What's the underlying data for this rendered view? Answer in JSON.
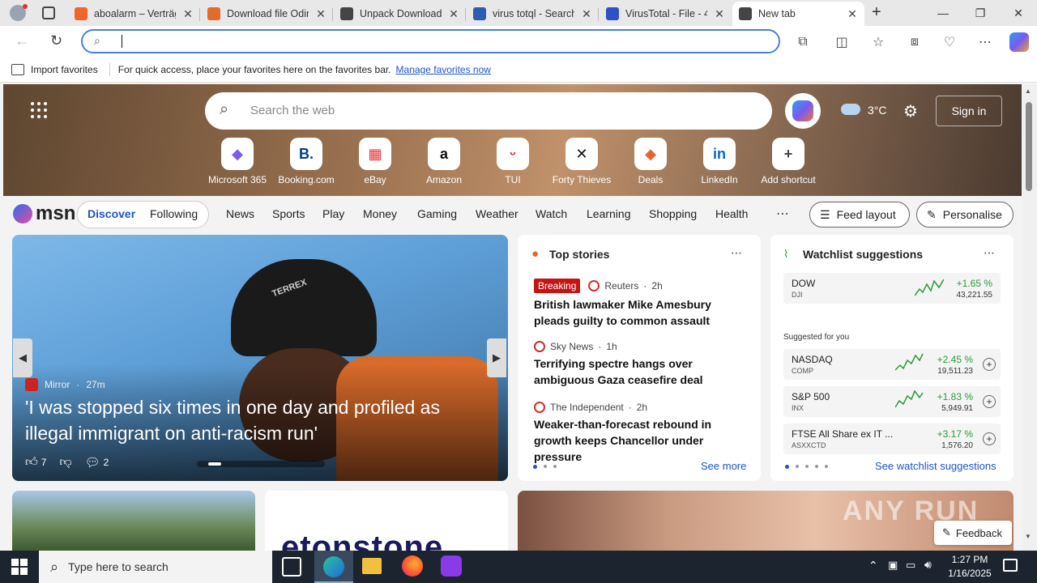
{
  "browser": {
    "tabs": [
      {
        "title": "aboalarm – Verträge",
        "color": "#f0662a",
        "active": false
      },
      {
        "title": "Download file Odin",
        "color": "#e36b2c",
        "active": false
      },
      {
        "title": "Unpack Download",
        "color": "#444444",
        "active": false
      },
      {
        "title": "virus totql - Search",
        "color": "#2a5db0",
        "active": false
      },
      {
        "title": "VirusTotal - File - 4",
        "color": "#3050c8",
        "active": false
      },
      {
        "title": "New tab",
        "color": "#444444",
        "active": true
      }
    ],
    "address_value": "",
    "favorites_bar": {
      "import_label": "Import favorites",
      "hint": "For quick access, place your favorites here on the favorites bar.",
      "manage_link": "Manage favorites now"
    }
  },
  "msn": {
    "search_placeholder": "Search the web",
    "weather": "3°C",
    "sign_in": "Sign in",
    "shortcuts": [
      {
        "label": "Microsoft 365",
        "glyph": "◆",
        "color": "#7a5af0"
      },
      {
        "label": "Booking.com",
        "glyph": "B.",
        "color": "#003a8c"
      },
      {
        "label": "eBay",
        "glyph": "▦",
        "color": "#e53238"
      },
      {
        "label": "Amazon",
        "glyph": "a",
        "color": "#111111"
      },
      {
        "label": "TUI",
        "glyph": "ᵕ",
        "color": "#d8232a"
      },
      {
        "label": "Forty Thieves",
        "glyph": "✕",
        "color": "#111111"
      },
      {
        "label": "Deals",
        "glyph": "◆",
        "color": "#e8642c"
      },
      {
        "label": "LinkedIn",
        "glyph": "in",
        "color": "#0a66c2"
      },
      {
        "label": "Add shortcut",
        "glyph": "+",
        "color": "#444444"
      }
    ],
    "logo_text": "msn",
    "tabs": {
      "discover": "Discover",
      "following": "Following"
    },
    "nav": [
      "News",
      "Sports",
      "Play",
      "Money",
      "Gaming",
      "Weather",
      "Watch",
      "Learning",
      "Shopping",
      "Health"
    ],
    "feed_layout": "Feed layout",
    "personalise": "Personalise",
    "hero_story": {
      "source": "Mirror",
      "time": "27m",
      "headline": "'I was stopped six times in one day and profiled as illegal immigrant on anti-racism run'",
      "likes": "7",
      "comments": "2",
      "hat_text": "TERREX"
    },
    "top_stories": {
      "title": "Top stories",
      "items": [
        {
          "badge": "Breaking",
          "source": "Reuters",
          "time": "2h",
          "headline": "British lawmaker Mike Amesbury pleads guilty to common assault"
        },
        {
          "badge": "",
          "source": "Sky News",
          "time": "1h",
          "headline": "Terrifying spectre hangs over ambiguous Gaza ceasefire deal"
        },
        {
          "badge": "",
          "source": "The Independent",
          "time": "2h",
          "headline": "Weaker-than-forecast rebound in growth keeps Chancellor under pressure"
        }
      ],
      "see_more": "See more"
    },
    "watchlist": {
      "title": "Watchlist suggestions",
      "main": {
        "name": "DOW",
        "sub": "DJI",
        "change": "+1.65 %",
        "value": "43,221.55"
      },
      "suggested_label": "Suggested for you",
      "items": [
        {
          "name": "NASDAQ",
          "sub": "COMP",
          "change": "+2.45 %",
          "value": "19,511.23"
        },
        {
          "name": "S&P 500",
          "sub": "INX",
          "change": "+1.83 %",
          "value": "5,949.91"
        },
        {
          "name": "FTSE All Share ex IT ...",
          "sub": "ASXXCTD",
          "change": "+3.17 %",
          "value": "1,576.20"
        }
      ],
      "see_link": "See watchlist suggestions"
    },
    "feedback": "Feedback",
    "bottom_banner_text": "etonstone",
    "watermark": "ANY RUN"
  },
  "taskbar": {
    "search_placeholder": "Type here to search",
    "time": "1:27 PM",
    "date": "1/16/2025"
  }
}
